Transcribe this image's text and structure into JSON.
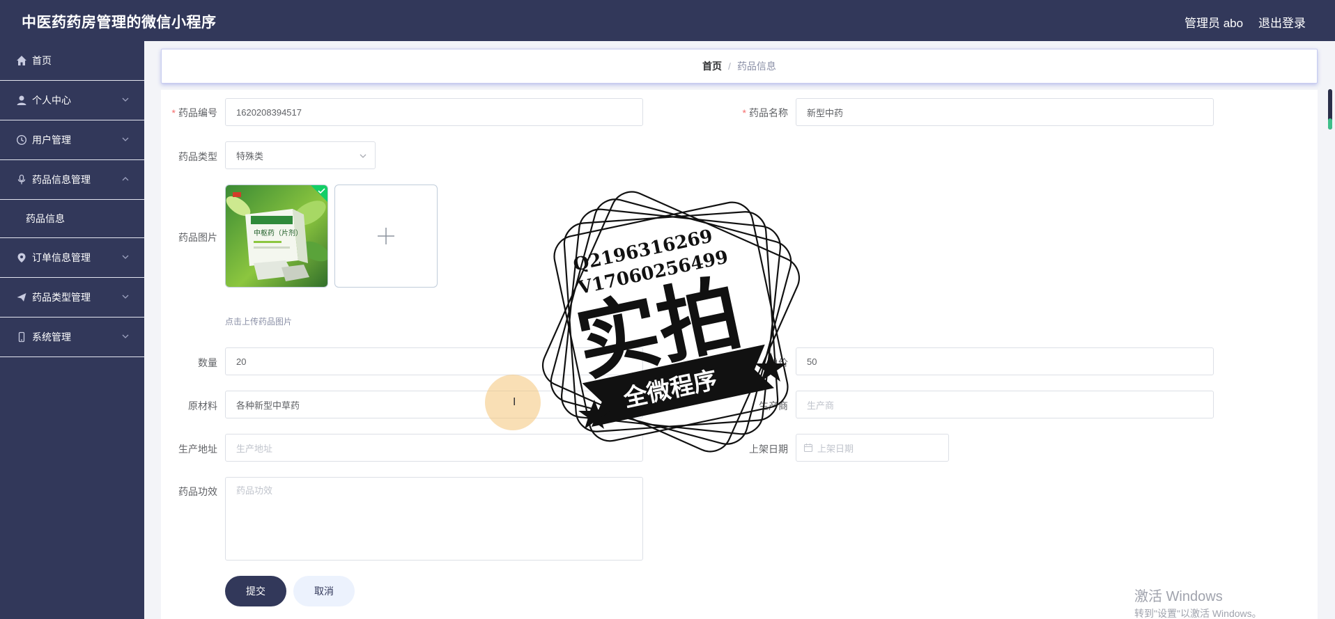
{
  "header": {
    "title": "中医药药房管理的微信小程序",
    "user": "管理员 abo",
    "logout": "退出登录"
  },
  "sidebar": {
    "items": [
      {
        "label": "首页",
        "icon": "home-icon"
      },
      {
        "label": "个人中心",
        "icon": "user-icon"
      },
      {
        "label": "用户管理",
        "icon": "clock-icon"
      },
      {
        "label": "药品信息管理",
        "icon": "microphone-icon",
        "expanded": true
      },
      {
        "label": "订单信息管理",
        "icon": "location-icon"
      },
      {
        "label": "药品类型管理",
        "icon": "send-icon"
      },
      {
        "label": "系统管理",
        "icon": "phone-icon"
      }
    ],
    "sub_item": "药品信息"
  },
  "breadcrumb": {
    "home": "首页",
    "separator": "/",
    "current": "药品信息"
  },
  "form": {
    "drug_code_label": "药品编号",
    "drug_code_value": "1620208394517",
    "drug_name_label": "药品名称",
    "drug_name_value": "新型中药",
    "drug_type_label": "药品类型",
    "drug_type_value": "特殊类",
    "drug_image_label": "药品图片",
    "upload_tip": "点击上传药品图片",
    "quantity_label": "数量",
    "quantity_value": "20",
    "price_label": "单价",
    "price_value": "50",
    "material_label": "原材料",
    "material_value": "各种新型中草药",
    "manufacturer_label": "生产商",
    "manufacturer_placeholder": "生产商",
    "address_label": "生产地址",
    "address_placeholder": "生产地址",
    "shelf_date_label": "上架日期",
    "shelf_date_placeholder": "上架日期",
    "effect_label": "药品功效",
    "effect_placeholder": "药品功效",
    "submit": "提交",
    "cancel": "取消"
  },
  "image_thumb": {
    "product_title": "中枢药（片剂）"
  },
  "watermark": {
    "line1": "Q2196316269",
    "line2": "V17060256499",
    "big": "实拍",
    "banner": "全微程序"
  },
  "system": {
    "activate_title": "激活 Windows",
    "activate_hint": "转到\"设置\"以激活 Windows。"
  },
  "colors": {
    "nav_bg": "#32385a",
    "primary": "#32385a",
    "required": "#f56c6c",
    "success": "#13ce66"
  }
}
